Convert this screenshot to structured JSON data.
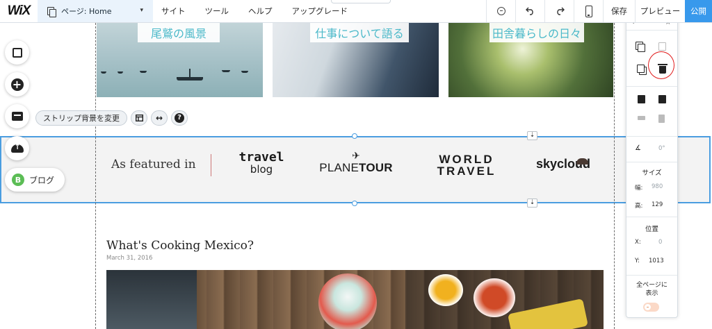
{
  "topbar": {
    "logo": "WiX",
    "page_selector": "ページ: Home",
    "menu": [
      "サイト",
      "ツール",
      "ヘルプ",
      "アップグレード"
    ],
    "save": "保存",
    "preview": "プレビュー",
    "publish": "公開"
  },
  "gallery": [
    {
      "caption": "尾鷲の風景"
    },
    {
      "caption": "仕事について語る"
    },
    {
      "caption": "田舎暮らしの日々"
    }
  ],
  "left_tools": {
    "blog_badge": "B",
    "blog_label": "ブログ",
    "strip_bg_button": "ストリップ背景を変更",
    "help": "?"
  },
  "strip": {
    "featured_text": "As featured in",
    "logos": {
      "travel_line1": "travel",
      "travel_line2": "blog",
      "plane_thin": "PLANE",
      "plane_bold": "TOUR",
      "world": "WORLD",
      "travel": "TRAVEL",
      "skycloud": "skycloud"
    }
  },
  "post": {
    "title": "What's Cooking Mexico?",
    "date": "March 31, 2016"
  },
  "panel": {
    "angle_value": "0°",
    "size_label": "サイズ",
    "width_key": "幅:",
    "width_value": "980",
    "height_key": "高:",
    "height_value": "129",
    "position_label": "位置",
    "x_key": "X:",
    "x_value": "0",
    "y_key": "Y:",
    "y_value": "1013",
    "show_all_pages": [
      "全ページに",
      "表示"
    ]
  },
  "colors": {
    "accent": "#3899ec",
    "selection": "#4a9de0",
    "caption": "#4bb9c9",
    "annotation": "#e01b1b"
  }
}
